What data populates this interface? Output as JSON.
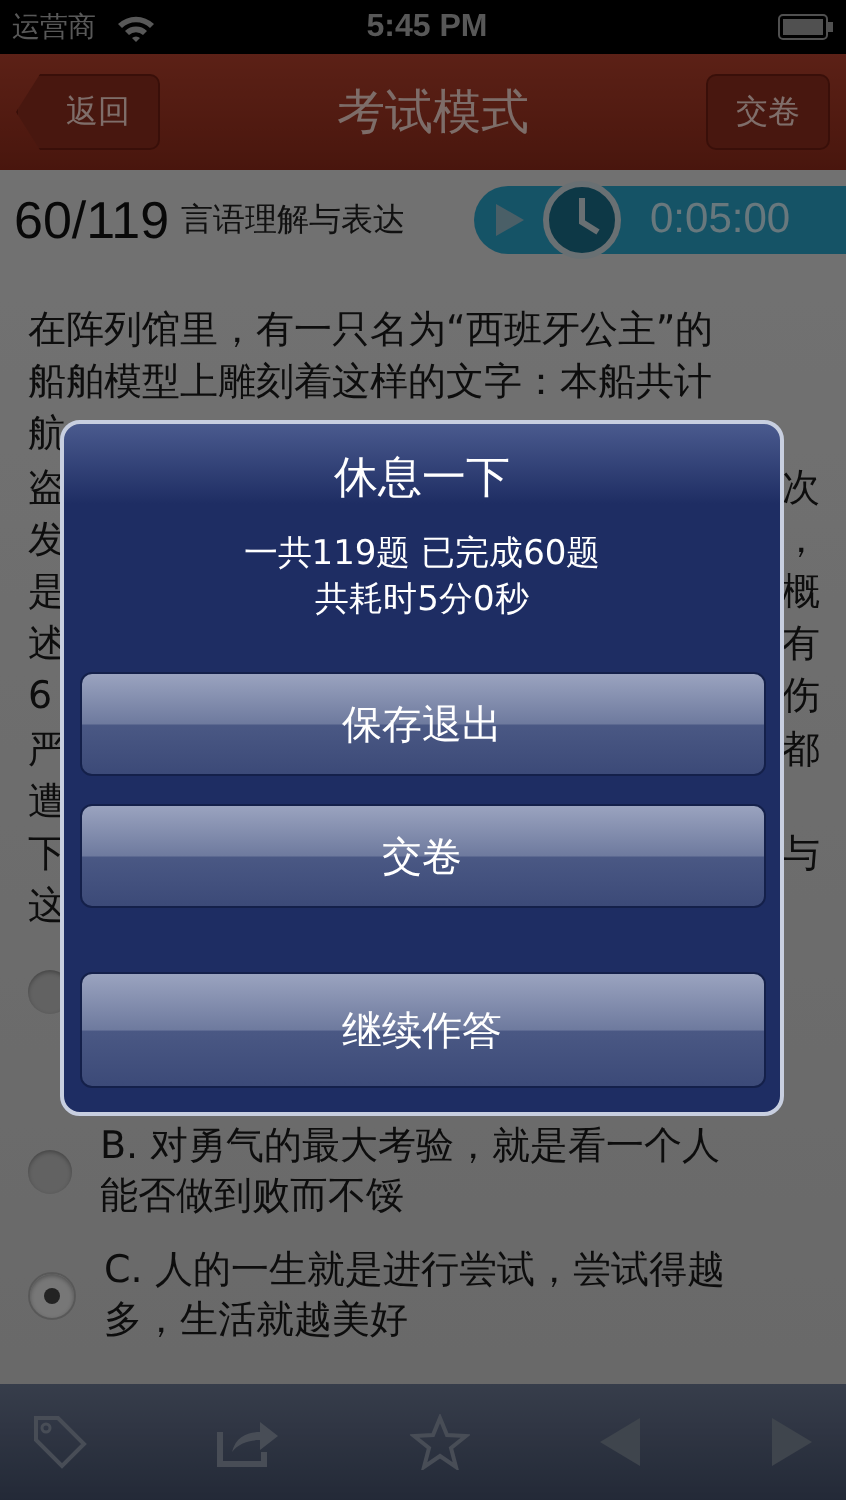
{
  "status_bar": {
    "carrier": "运营商",
    "time": "5:45 PM"
  },
  "nav_bar": {
    "back": "返回",
    "title": "考试模式",
    "submit": "交卷"
  },
  "question_header": {
    "progress": "60/119",
    "category": "言语理解与表达",
    "timer": "0:05:00"
  },
  "question": {
    "lines": [
      "在阵列馆里，有一只名为“西班牙公主”的",
      "船舶模型上雕刻着这样的文字：本船共计"
    ],
    "covered_lines": [
      {
        "start": "航"
      },
      {
        "start": "盗",
        "end": "次"
      },
      {
        "start": "发",
        "end": "，"
      },
      {
        "start": "是",
        "end": "概"
      },
      {
        "start": "述",
        "end": "有"
      },
      {
        "start": "6",
        "end": "伤"
      },
      {
        "start": "严",
        "end": "都"
      },
      {
        "start": "遭"
      },
      {
        "start": "下",
        "end": "与"
      },
      {
        "start": "这"
      }
    ],
    "options": [
      {
        "selected": false
      },
      {
        "text": "B. 对勇气的最大考验，就是看一个人能否做到败而不馁",
        "selected": false
      },
      {
        "text": "C. 人的一生就是进行尝试，尝试得越多，生活就越美好",
        "selected": true
      }
    ]
  },
  "dialog": {
    "title": "休息一下",
    "message": [
      "一共119题 已完成60题",
      "共耗时5分0秒"
    ],
    "buttons": [
      "保存退出",
      "交卷",
      "继续作答"
    ]
  }
}
